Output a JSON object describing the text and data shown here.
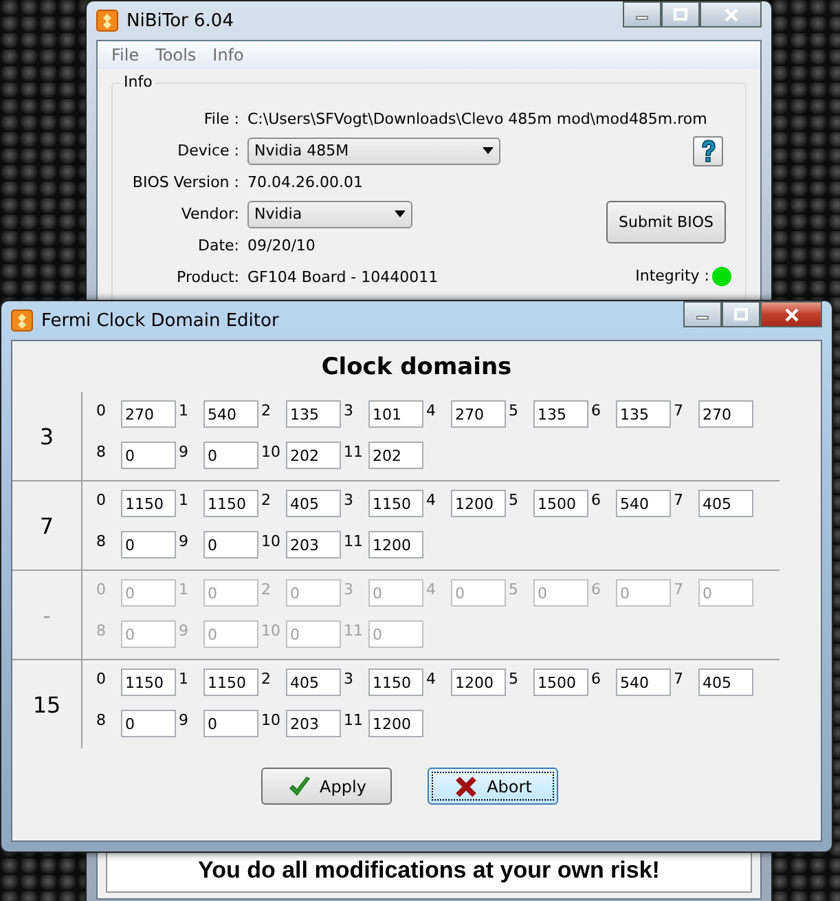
{
  "main_window": {
    "title": "NiBiTor 6.04",
    "menu": [
      "File",
      "Tools",
      "Info"
    ],
    "info_group": {
      "title": "Info",
      "rows": [
        {
          "label": "File :",
          "value": "C:\\Users\\SFVogt\\Downloads\\Clevo 485m mod\\mod485m.rom",
          "kind": "text"
        },
        {
          "label": "Device :",
          "value": "Nvidia 485M",
          "kind": "dropdown"
        },
        {
          "label": "BIOS Version :",
          "value": "70.04.26.00.01",
          "kind": "text"
        },
        {
          "label": "Vendor:",
          "value": "Nvidia",
          "kind": "dropdown"
        },
        {
          "label": "Date:",
          "value": "09/20/10",
          "kind": "text"
        },
        {
          "label": "Product:",
          "value": "GF104 Board - 10440011",
          "kind": "text"
        }
      ],
      "submit_button": "Submit BIOS",
      "integrity_label": "Integrity :",
      "integrity_ok": true
    },
    "footer": "You do all modifications at your own risk!"
  },
  "editor_window": {
    "title": "Fermi Clock Domain Editor",
    "heading": "Clock domains",
    "groups": [
      {
        "label": "3",
        "disabled": false,
        "fields": [
          {
            "index": "0",
            "value": "270"
          },
          {
            "index": "1",
            "value": "540"
          },
          {
            "index": "2",
            "value": "135"
          },
          {
            "index": "3",
            "value": "101"
          },
          {
            "index": "4",
            "value": "270"
          },
          {
            "index": "5",
            "value": "135"
          },
          {
            "index": "6",
            "value": "135"
          },
          {
            "index": "7",
            "value": "270"
          },
          {
            "index": "8",
            "value": "0"
          },
          {
            "index": "9",
            "value": "0"
          },
          {
            "index": "10",
            "value": "202"
          },
          {
            "index": "11",
            "value": "202"
          }
        ]
      },
      {
        "label": "7",
        "disabled": false,
        "fields": [
          {
            "index": "0",
            "value": "1150"
          },
          {
            "index": "1",
            "value": "1150"
          },
          {
            "index": "2",
            "value": "405"
          },
          {
            "index": "3",
            "value": "1150"
          },
          {
            "index": "4",
            "value": "1200"
          },
          {
            "index": "5",
            "value": "1500"
          },
          {
            "index": "6",
            "value": "540"
          },
          {
            "index": "7",
            "value": "405"
          },
          {
            "index": "8",
            "value": "0"
          },
          {
            "index": "9",
            "value": "0"
          },
          {
            "index": "10",
            "value": "203"
          },
          {
            "index": "11",
            "value": "1200"
          }
        ]
      },
      {
        "label": "-",
        "disabled": true,
        "fields": [
          {
            "index": "0",
            "value": "0"
          },
          {
            "index": "1",
            "value": "0"
          },
          {
            "index": "2",
            "value": "0"
          },
          {
            "index": "3",
            "value": "0"
          },
          {
            "index": "4",
            "value": "0"
          },
          {
            "index": "5",
            "value": "0"
          },
          {
            "index": "6",
            "value": "0"
          },
          {
            "index": "7",
            "value": "0"
          },
          {
            "index": "8",
            "value": "0"
          },
          {
            "index": "9",
            "value": "0"
          },
          {
            "index": "10",
            "value": "0"
          },
          {
            "index": "11",
            "value": "0"
          }
        ]
      },
      {
        "label": "15",
        "disabled": false,
        "fields": [
          {
            "index": "0",
            "value": "1150"
          },
          {
            "index": "1",
            "value": "1150"
          },
          {
            "index": "2",
            "value": "405"
          },
          {
            "index": "3",
            "value": "1150"
          },
          {
            "index": "4",
            "value": "1200"
          },
          {
            "index": "5",
            "value": "1500"
          },
          {
            "index": "6",
            "value": "540"
          },
          {
            "index": "7",
            "value": "405"
          },
          {
            "index": "8",
            "value": "0"
          },
          {
            "index": "9",
            "value": "0"
          },
          {
            "index": "10",
            "value": "203"
          },
          {
            "index": "11",
            "value": "1200"
          }
        ]
      }
    ],
    "buttons": [
      {
        "label": "Apply",
        "kind": "apply",
        "focused": false
      },
      {
        "label": "Abort",
        "kind": "abort",
        "focused": true
      }
    ]
  }
}
